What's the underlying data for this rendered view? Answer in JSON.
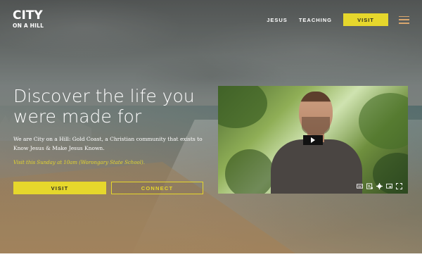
{
  "brand": {
    "line1": "CITY",
    "line2": "ON A HILL"
  },
  "nav": {
    "jesus": "JESUS",
    "teaching": "TEACHING",
    "visit": "VISIT",
    "menu_icon": "hamburger-menu-icon"
  },
  "hero": {
    "headline": "Discover the life you were made for",
    "description": "We are City on a Hill: Gold Coast, a Christian community that exists to Know Jesus & Make Jesus Known.",
    "visit_note": "Visit this Sunday at 10am (Worongary State School).",
    "visit_button": "VISIT",
    "connect_button": "CONNECT"
  },
  "video": {
    "play_icon": "play-icon",
    "controls": [
      "keyboard-icon",
      "captions-icon",
      "settings-icon",
      "cast-icon",
      "fullscreen-icon"
    ]
  },
  "colors": {
    "accent": "#e6d72c",
    "menu_icon": "#d9a76e"
  }
}
